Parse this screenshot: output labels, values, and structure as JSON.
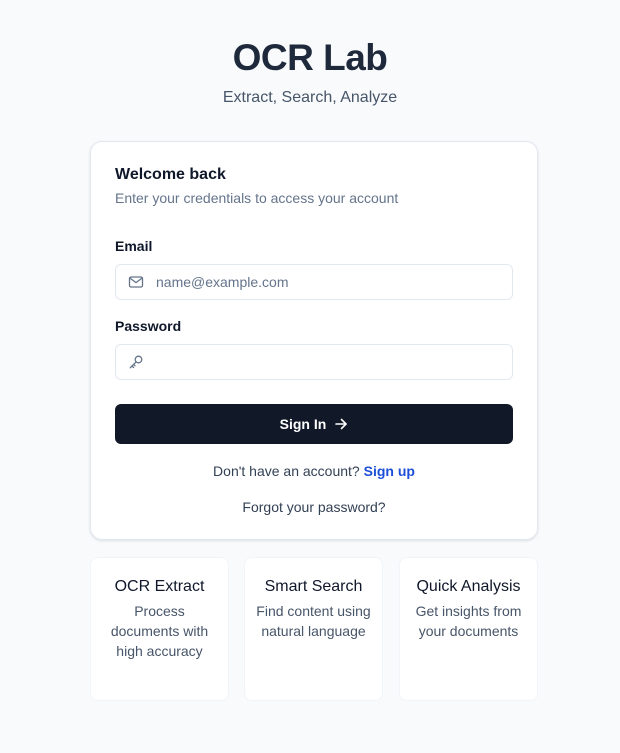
{
  "header": {
    "title": "OCR Lab",
    "subtitle": "Extract, Search, Analyze"
  },
  "login": {
    "title": "Welcome back",
    "description": "Enter your credentials to access your account",
    "email": {
      "label": "Email",
      "placeholder": "name@example.com",
      "value": "",
      "icon": "mail-icon"
    },
    "password": {
      "label": "Password",
      "placeholder": "",
      "value": "",
      "icon": "key-icon"
    },
    "submit_label": "Sign In",
    "submit_icon": "arrow-right-icon",
    "signup_prompt": "Don't have an account?",
    "signup_link": "Sign up",
    "forgot_link": "Forgot your password?"
  },
  "features": [
    {
      "title": "OCR Extract",
      "description": "Process documents with high accuracy"
    },
    {
      "title": "Smart Search",
      "description": "Find content using natural language"
    },
    {
      "title": "Quick Analysis",
      "description": "Get insights from your documents"
    }
  ],
  "colors": {
    "background": "#f8fafc",
    "primary_button": "#111827",
    "link": "#1d4ed8",
    "border": "#e2e8f0"
  }
}
